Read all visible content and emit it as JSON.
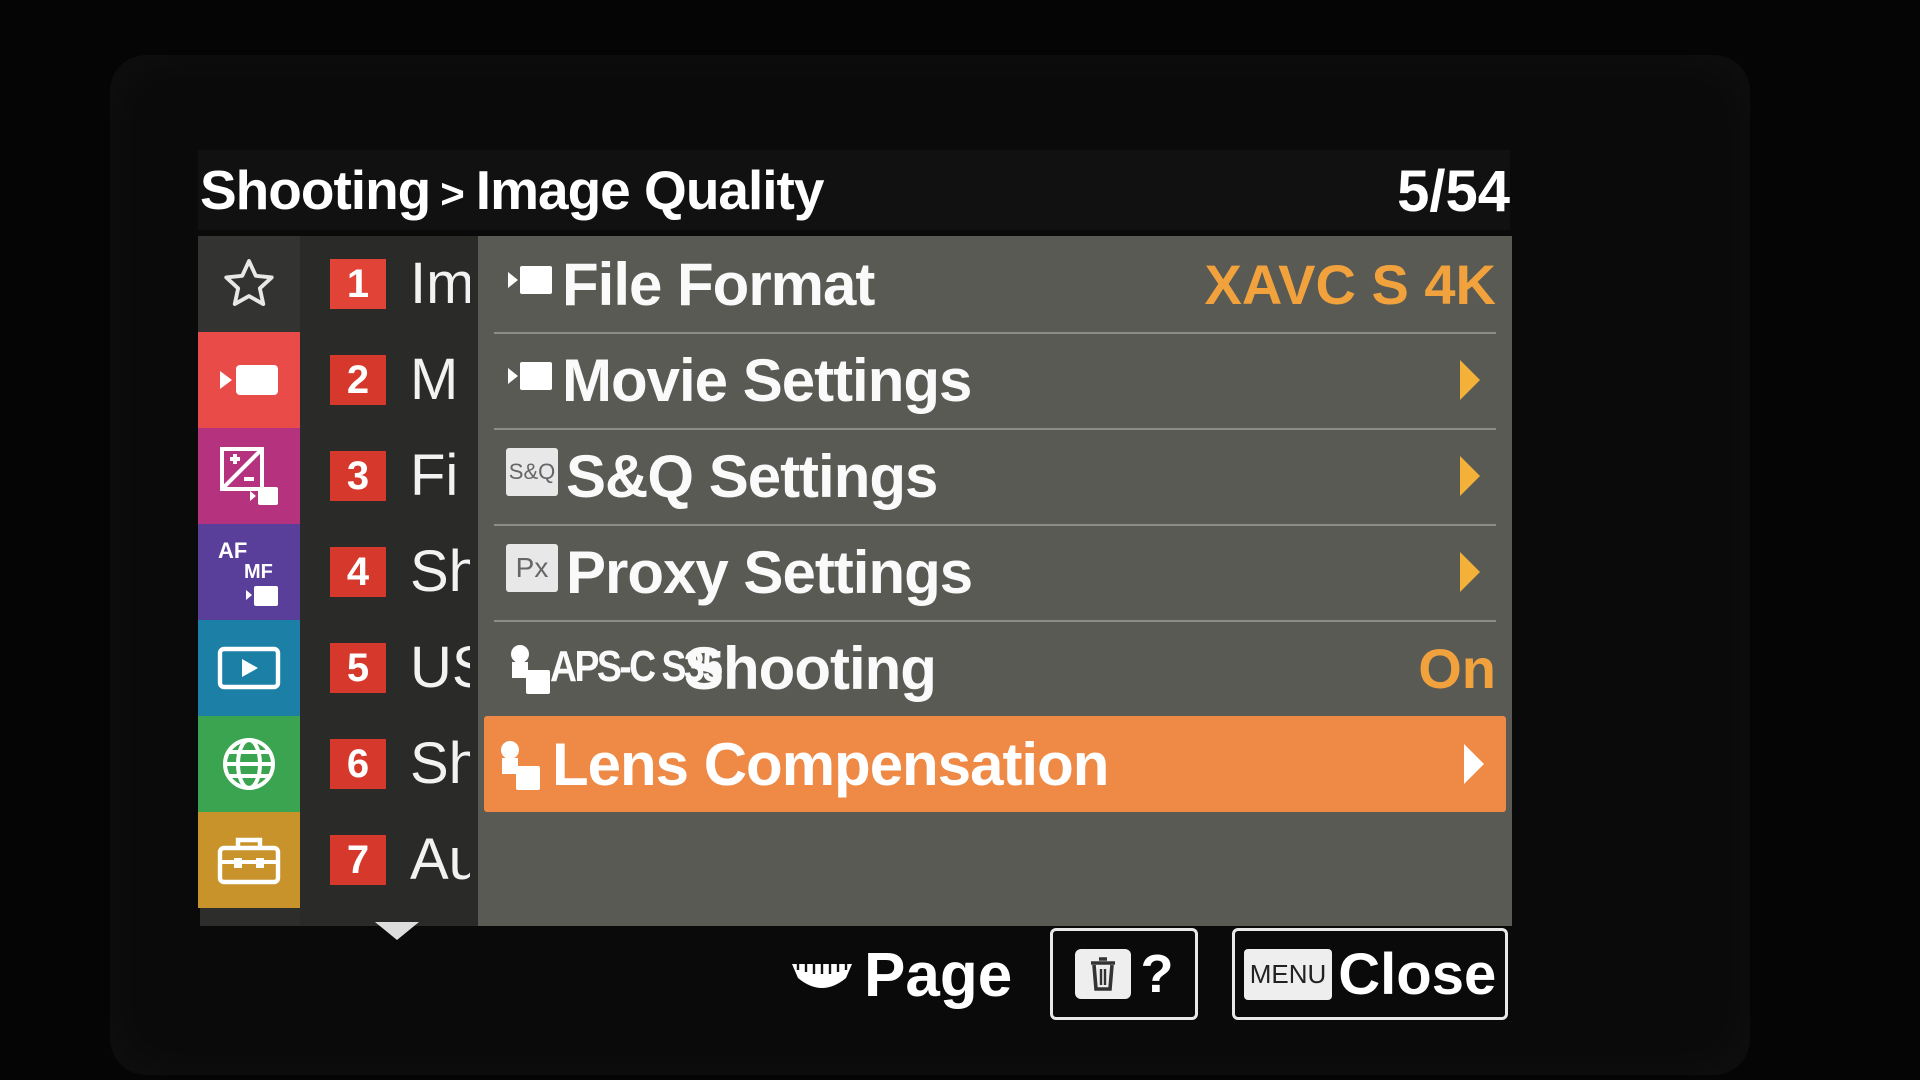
{
  "header": {
    "breadcrumb_parent": "Shooting",
    "breadcrumb_separator": ">",
    "breadcrumb_current": "Image Quality",
    "page_counter": "5/54"
  },
  "categories": [
    {
      "icon": "star-icon",
      "color": "#333331",
      "active": false
    },
    {
      "icon": "movie-camera-icon",
      "color": "#e94b48",
      "active": true
    },
    {
      "icon": "exposure-icon",
      "color": "#b4327e",
      "active": false
    },
    {
      "icon": "af-mf-icon",
      "color": "#5a3f9a",
      "active": false
    },
    {
      "icon": "playback-icon",
      "color": "#1b7fa6",
      "active": false
    },
    {
      "icon": "globe-icon",
      "color": "#3ba450",
      "active": false
    },
    {
      "icon": "toolbox-icon",
      "color": "#c9932c",
      "active": false
    }
  ],
  "pages": [
    {
      "number": "1",
      "name": "Im"
    },
    {
      "number": "2",
      "name": "M"
    },
    {
      "number": "3",
      "name": "Fi"
    },
    {
      "number": "4",
      "name": "Sh"
    },
    {
      "number": "5",
      "name": "US"
    },
    {
      "number": "6",
      "name": "Sh"
    },
    {
      "number": "7",
      "name": "Au"
    }
  ],
  "items": [
    {
      "icon": "movie-icon",
      "label": "File Format",
      "value": "XAVC S 4K",
      "arrow": false
    },
    {
      "icon": "movie-icon",
      "label": "Movie Settings",
      "value": "",
      "arrow": true
    },
    {
      "icon": "sq-icon",
      "icon_text": "S&Q",
      "label": "S&Q Settings",
      "value": "",
      "arrow": true
    },
    {
      "icon": "proxy-icon",
      "icon_text": "Px",
      "label": "Proxy Settings",
      "value": "",
      "arrow": true
    },
    {
      "icon": "camera-lens-icon",
      "prefix": "APS-C S35",
      "label": "Shooting",
      "value": "On",
      "arrow": false
    },
    {
      "icon": "camera-lens-icon",
      "label": "Lens Compensation",
      "value": "",
      "arrow": true,
      "selected": true
    }
  ],
  "footer": {
    "page_label": "Page",
    "help_label": "?",
    "menu_key": "MENU",
    "close_label": "Close"
  },
  "colors": {
    "selected": "#ef8a46",
    "value": "#f2a23c",
    "page_badge": "#d6392c"
  }
}
